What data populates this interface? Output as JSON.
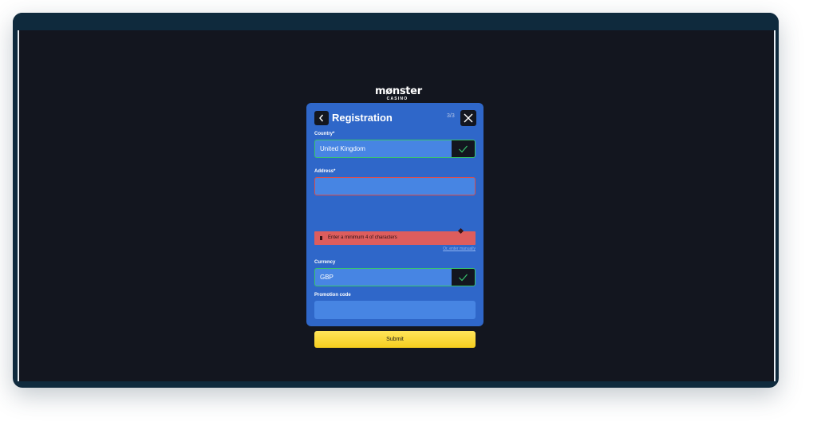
{
  "logo": {
    "line1": "mønster",
    "line2": "CASINO"
  },
  "modal": {
    "title": "Registration",
    "step": "3/3",
    "back_icon": "chevron-left-icon",
    "close_icon": "close-icon"
  },
  "form": {
    "country": {
      "label": "Country*",
      "value": "United Kingdom",
      "valid": true
    },
    "address": {
      "label": "Address*",
      "value": "",
      "error": "Enter a minimum 4 of characters",
      "manual_link": "Or, enter manually"
    },
    "currency": {
      "label": "Currency",
      "value": "GBP",
      "valid": true
    },
    "promo": {
      "label": "Promotion code",
      "value": ""
    },
    "submit_label": "Submit"
  },
  "colors": {
    "frame": "#0f2a3d",
    "background": "#13161f",
    "modal": "#2f67c9",
    "field": "#4785e3",
    "valid_border": "#38c46c",
    "error": "#dd5d5d",
    "submit": "#f8d62e"
  }
}
